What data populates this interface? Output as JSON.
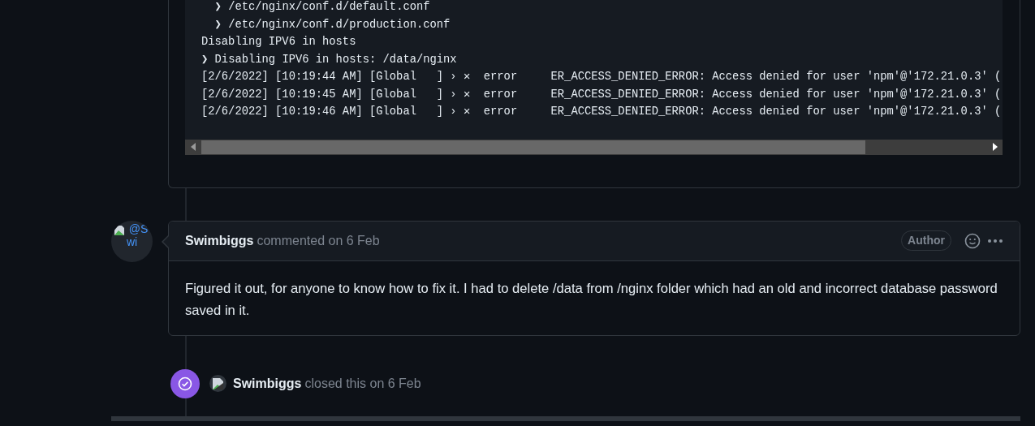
{
  "log_block": {
    "lines": [
      "  ❯ /etc/nginx/conf.d/default.conf",
      "  ❯ /etc/nginx/conf.d/production.conf",
      "Disabling IPV6 in hosts",
      "❯ Disabling IPV6 in hosts: /data/nginx",
      "[2/6/2022] [10:19:44 AM] [Global   ] › ✕  error     ER_ACCESS_DENIED_ERROR: Access denied for user 'npm'@'172.21.0.3' (",
      "[2/6/2022] [10:19:45 AM] [Global   ] › ✕  error     ER_ACCESS_DENIED_ERROR: Access denied for user 'npm'@'172.21.0.3' (",
      "[2/6/2022] [10:19:46 AM] [Global   ] › ✕  error     ER_ACCESS_DENIED_ERROR: Access denied for user 'npm'@'172.21.0.3' ("
    ]
  },
  "comment": {
    "avatar_alt": [
      "@S",
      "wi"
    ],
    "author": "Swimbiggs",
    "action": "commented on 6 Feb",
    "badge": "Author",
    "body": "Figured it out, for anyone to know how to fix it. I had to delete /data from /nginx folder which had an old and incorrect database password saved in it."
  },
  "event": {
    "kind": "closed",
    "actor": "Swimbiggs",
    "action": "closed this on 6 Feb"
  }
}
